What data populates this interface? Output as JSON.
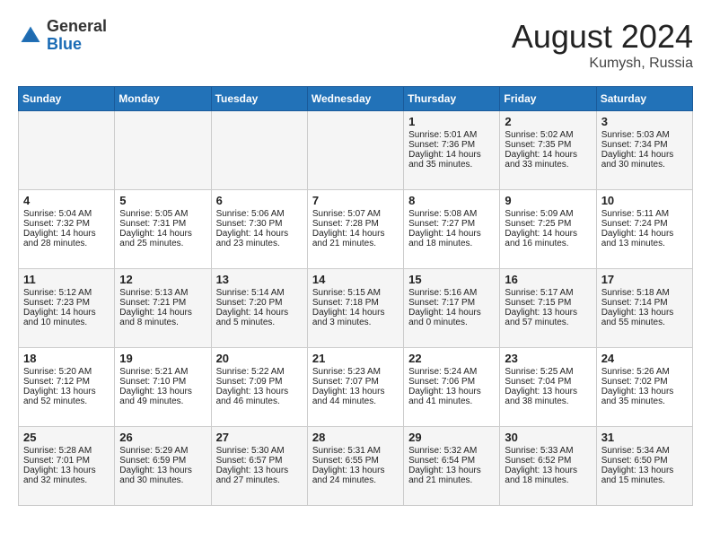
{
  "header": {
    "logo_general": "General",
    "logo_blue": "Blue",
    "month_year": "August 2024",
    "location": "Kumysh, Russia"
  },
  "days_of_week": [
    "Sunday",
    "Monday",
    "Tuesday",
    "Wednesday",
    "Thursday",
    "Friday",
    "Saturday"
  ],
  "weeks": [
    {
      "days": [
        {
          "num": "",
          "content": ""
        },
        {
          "num": "",
          "content": ""
        },
        {
          "num": "",
          "content": ""
        },
        {
          "num": "",
          "content": ""
        },
        {
          "num": "1",
          "content": "Sunrise: 5:01 AM\nSunset: 7:36 PM\nDaylight: 14 hours\nand 35 minutes."
        },
        {
          "num": "2",
          "content": "Sunrise: 5:02 AM\nSunset: 7:35 PM\nDaylight: 14 hours\nand 33 minutes."
        },
        {
          "num": "3",
          "content": "Sunrise: 5:03 AM\nSunset: 7:34 PM\nDaylight: 14 hours\nand 30 minutes."
        }
      ]
    },
    {
      "days": [
        {
          "num": "4",
          "content": "Sunrise: 5:04 AM\nSunset: 7:32 PM\nDaylight: 14 hours\nand 28 minutes."
        },
        {
          "num": "5",
          "content": "Sunrise: 5:05 AM\nSunset: 7:31 PM\nDaylight: 14 hours\nand 25 minutes."
        },
        {
          "num": "6",
          "content": "Sunrise: 5:06 AM\nSunset: 7:30 PM\nDaylight: 14 hours\nand 23 minutes."
        },
        {
          "num": "7",
          "content": "Sunrise: 5:07 AM\nSunset: 7:28 PM\nDaylight: 14 hours\nand 21 minutes."
        },
        {
          "num": "8",
          "content": "Sunrise: 5:08 AM\nSunset: 7:27 PM\nDaylight: 14 hours\nand 18 minutes."
        },
        {
          "num": "9",
          "content": "Sunrise: 5:09 AM\nSunset: 7:25 PM\nDaylight: 14 hours\nand 16 minutes."
        },
        {
          "num": "10",
          "content": "Sunrise: 5:11 AM\nSunset: 7:24 PM\nDaylight: 14 hours\nand 13 minutes."
        }
      ]
    },
    {
      "days": [
        {
          "num": "11",
          "content": "Sunrise: 5:12 AM\nSunset: 7:23 PM\nDaylight: 14 hours\nand 10 minutes."
        },
        {
          "num": "12",
          "content": "Sunrise: 5:13 AM\nSunset: 7:21 PM\nDaylight: 14 hours\nand 8 minutes."
        },
        {
          "num": "13",
          "content": "Sunrise: 5:14 AM\nSunset: 7:20 PM\nDaylight: 14 hours\nand 5 minutes."
        },
        {
          "num": "14",
          "content": "Sunrise: 5:15 AM\nSunset: 7:18 PM\nDaylight: 14 hours\nand 3 minutes."
        },
        {
          "num": "15",
          "content": "Sunrise: 5:16 AM\nSunset: 7:17 PM\nDaylight: 14 hours\nand 0 minutes."
        },
        {
          "num": "16",
          "content": "Sunrise: 5:17 AM\nSunset: 7:15 PM\nDaylight: 13 hours\nand 57 minutes."
        },
        {
          "num": "17",
          "content": "Sunrise: 5:18 AM\nSunset: 7:14 PM\nDaylight: 13 hours\nand 55 minutes."
        }
      ]
    },
    {
      "days": [
        {
          "num": "18",
          "content": "Sunrise: 5:20 AM\nSunset: 7:12 PM\nDaylight: 13 hours\nand 52 minutes."
        },
        {
          "num": "19",
          "content": "Sunrise: 5:21 AM\nSunset: 7:10 PM\nDaylight: 13 hours\nand 49 minutes."
        },
        {
          "num": "20",
          "content": "Sunrise: 5:22 AM\nSunset: 7:09 PM\nDaylight: 13 hours\nand 46 minutes."
        },
        {
          "num": "21",
          "content": "Sunrise: 5:23 AM\nSunset: 7:07 PM\nDaylight: 13 hours\nand 44 minutes."
        },
        {
          "num": "22",
          "content": "Sunrise: 5:24 AM\nSunset: 7:06 PM\nDaylight: 13 hours\nand 41 minutes."
        },
        {
          "num": "23",
          "content": "Sunrise: 5:25 AM\nSunset: 7:04 PM\nDaylight: 13 hours\nand 38 minutes."
        },
        {
          "num": "24",
          "content": "Sunrise: 5:26 AM\nSunset: 7:02 PM\nDaylight: 13 hours\nand 35 minutes."
        }
      ]
    },
    {
      "days": [
        {
          "num": "25",
          "content": "Sunrise: 5:28 AM\nSunset: 7:01 PM\nDaylight: 13 hours\nand 32 minutes."
        },
        {
          "num": "26",
          "content": "Sunrise: 5:29 AM\nSunset: 6:59 PM\nDaylight: 13 hours\nand 30 minutes."
        },
        {
          "num": "27",
          "content": "Sunrise: 5:30 AM\nSunset: 6:57 PM\nDaylight: 13 hours\nand 27 minutes."
        },
        {
          "num": "28",
          "content": "Sunrise: 5:31 AM\nSunset: 6:55 PM\nDaylight: 13 hours\nand 24 minutes."
        },
        {
          "num": "29",
          "content": "Sunrise: 5:32 AM\nSunset: 6:54 PM\nDaylight: 13 hours\nand 21 minutes."
        },
        {
          "num": "30",
          "content": "Sunrise: 5:33 AM\nSunset: 6:52 PM\nDaylight: 13 hours\nand 18 minutes."
        },
        {
          "num": "31",
          "content": "Sunrise: 5:34 AM\nSunset: 6:50 PM\nDaylight: 13 hours\nand 15 minutes."
        }
      ]
    }
  ]
}
